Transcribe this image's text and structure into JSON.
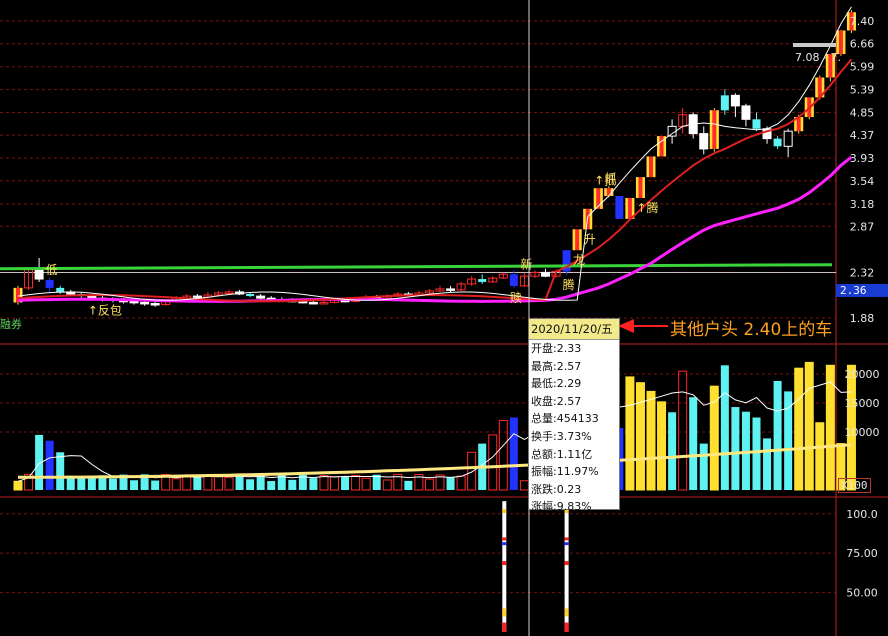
{
  "chart_data": [
    {
      "type": "candlestick",
      "panel": "price",
      "ylim": [
        1.88,
        8.0
      ],
      "y_ticks": [
        "7.40",
        "6.66",
        "5.99",
        "5.39",
        "4.85",
        "4.37",
        "3.93",
        "3.54",
        "3.18",
        "2.87",
        "2.32",
        "1.88"
      ],
      "current_price_label": "2.36",
      "range_label": "7.08 - 7.",
      "candles": [
        {
          "o": 2.02,
          "c": 2.16,
          "h": 2.18,
          "l": 2.0,
          "col": "yellow"
        },
        {
          "o": 2.16,
          "c": 2.35,
          "h": 2.36,
          "l": 2.14,
          "col": "red"
        },
        {
          "o": 2.36,
          "c": 2.25,
          "h": 2.48,
          "l": 2.22,
          "col": "white"
        },
        {
          "o": 2.24,
          "c": 2.16,
          "h": 2.26,
          "l": 2.12,
          "col": "blue"
        },
        {
          "o": 2.16,
          "c": 2.12,
          "h": 2.18,
          "l": 2.1,
          "col": "cyan"
        },
        {
          "o": 2.12,
          "c": 2.1,
          "h": 2.14,
          "l": 2.08,
          "col": "white"
        },
        {
          "o": 2.1,
          "c": 2.08,
          "h": 2.12,
          "l": 2.06,
          "col": "cyan"
        },
        {
          "o": 2.08,
          "c": 2.06,
          "h": 2.1,
          "l": 2.04,
          "col": "white"
        },
        {
          "o": 2.06,
          "c": 2.05,
          "h": 2.08,
          "l": 2.03,
          "col": "white"
        },
        {
          "o": 2.05,
          "c": 2.04,
          "h": 2.07,
          "l": 2.02,
          "col": "cyan"
        },
        {
          "o": 2.04,
          "c": 2.03,
          "h": 2.06,
          "l": 2.01,
          "col": "white"
        },
        {
          "o": 2.03,
          "c": 2.02,
          "h": 2.05,
          "l": 2.0,
          "col": "white"
        },
        {
          "o": 2.02,
          "c": 2.01,
          "h": 2.04,
          "l": 1.99,
          "col": "white"
        },
        {
          "o": 2.01,
          "c": 2.0,
          "h": 2.03,
          "l": 1.98,
          "col": "white"
        },
        {
          "o": 2.0,
          "c": 2.03,
          "h": 2.05,
          "l": 1.99,
          "col": "red"
        },
        {
          "o": 2.03,
          "c": 2.06,
          "h": 2.08,
          "l": 2.02,
          "col": "red"
        },
        {
          "o": 2.06,
          "c": 2.08,
          "h": 2.1,
          "l": 2.05,
          "col": "red"
        },
        {
          "o": 2.08,
          "c": 2.07,
          "h": 2.1,
          "l": 2.05,
          "col": "white"
        },
        {
          "o": 2.07,
          "c": 2.09,
          "h": 2.12,
          "l": 2.06,
          "col": "red"
        },
        {
          "o": 2.09,
          "c": 2.11,
          "h": 2.13,
          "l": 2.08,
          "col": "red"
        },
        {
          "o": 2.11,
          "c": 2.12,
          "h": 2.14,
          "l": 2.1,
          "col": "red"
        },
        {
          "o": 2.12,
          "c": 2.1,
          "h": 2.14,
          "l": 2.09,
          "col": "white"
        },
        {
          "o": 2.1,
          "c": 2.08,
          "h": 2.12,
          "l": 2.07,
          "col": "cyan"
        },
        {
          "o": 2.08,
          "c": 2.06,
          "h": 2.1,
          "l": 2.05,
          "col": "white"
        },
        {
          "o": 2.06,
          "c": 2.05,
          "h": 2.08,
          "l": 2.04,
          "col": "white"
        },
        {
          "o": 2.05,
          "c": 2.04,
          "h": 2.07,
          "l": 2.03,
          "col": "cyan"
        },
        {
          "o": 2.04,
          "c": 2.03,
          "h": 2.06,
          "l": 2.02,
          "col": "white"
        },
        {
          "o": 2.03,
          "c": 2.02,
          "h": 2.05,
          "l": 2.01,
          "col": "white"
        },
        {
          "o": 2.02,
          "c": 2.01,
          "h": 2.04,
          "l": 2.0,
          "col": "white"
        },
        {
          "o": 2.01,
          "c": 2.02,
          "h": 2.04,
          "l": 2.0,
          "col": "red"
        },
        {
          "o": 2.02,
          "c": 2.04,
          "h": 2.06,
          "l": 2.01,
          "col": "red"
        },
        {
          "o": 2.04,
          "c": 2.03,
          "h": 2.06,
          "l": 2.02,
          "col": "white"
        },
        {
          "o": 2.03,
          "c": 2.05,
          "h": 2.07,
          "l": 2.02,
          "col": "red"
        },
        {
          "o": 2.05,
          "c": 2.07,
          "h": 2.09,
          "l": 2.04,
          "col": "red"
        },
        {
          "o": 2.07,
          "c": 2.06,
          "h": 2.09,
          "l": 2.05,
          "col": "white"
        },
        {
          "o": 2.06,
          "c": 2.08,
          "h": 2.1,
          "l": 2.05,
          "col": "red"
        },
        {
          "o": 2.08,
          "c": 2.1,
          "h": 2.12,
          "l": 2.07,
          "col": "red"
        },
        {
          "o": 2.1,
          "c": 2.09,
          "h": 2.12,
          "l": 2.08,
          "col": "white"
        },
        {
          "o": 2.09,
          "c": 2.11,
          "h": 2.13,
          "l": 2.08,
          "col": "red"
        },
        {
          "o": 2.11,
          "c": 2.13,
          "h": 2.15,
          "l": 2.1,
          "col": "red"
        },
        {
          "o": 2.13,
          "c": 2.15,
          "h": 2.18,
          "l": 2.12,
          "col": "red"
        },
        {
          "o": 2.15,
          "c": 2.14,
          "h": 2.18,
          "l": 2.12,
          "col": "white"
        },
        {
          "o": 2.14,
          "c": 2.2,
          "h": 2.22,
          "l": 2.13,
          "col": "red"
        },
        {
          "o": 2.2,
          "c": 2.25,
          "h": 2.28,
          "l": 2.18,
          "col": "red"
        },
        {
          "o": 2.25,
          "c": 2.22,
          "h": 2.3,
          "l": 2.2,
          "col": "cyan"
        },
        {
          "o": 2.22,
          "c": 2.26,
          "h": 2.28,
          "l": 2.21,
          "col": "red"
        },
        {
          "o": 2.26,
          "c": 2.3,
          "h": 2.32,
          "l": 2.25,
          "col": "red"
        },
        {
          "o": 2.3,
          "c": 2.18,
          "h": 2.34,
          "l": 2.16,
          "col": "blue"
        },
        {
          "o": 2.18,
          "c": 2.28,
          "h": 2.32,
          "l": 2.17,
          "col": "red"
        },
        {
          "o": 2.28,
          "c": 2.32,
          "h": 2.34,
          "l": 2.26,
          "col": "red"
        },
        {
          "o": 2.32,
          "c": 2.28,
          "h": 2.36,
          "l": 2.27,
          "col": "white"
        },
        {
          "o": 2.28,
          "c": 2.33,
          "h": 2.35,
          "l": 2.27,
          "col": "red"
        },
        {
          "o": 2.33,
          "c": 2.57,
          "h": 2.57,
          "l": 2.29,
          "col": "blue"
        },
        {
          "o": 2.57,
          "c": 2.83,
          "h": 2.83,
          "l": 2.57,
          "col": "yellow"
        },
        {
          "o": 2.83,
          "c": 3.11,
          "h": 3.11,
          "l": 2.83,
          "col": "yellow"
        },
        {
          "o": 3.11,
          "c": 3.42,
          "h": 3.42,
          "l": 3.11,
          "col": "yellow"
        },
        {
          "o": 3.42,
          "c": 3.3,
          "h": 3.45,
          "l": 3.28,
          "col": "yellow"
        },
        {
          "o": 3.3,
          "c": 2.97,
          "h": 3.3,
          "l": 2.97,
          "col": "blue"
        },
        {
          "o": 2.97,
          "c": 3.27,
          "h": 3.27,
          "l": 2.97,
          "col": "yellow"
        },
        {
          "o": 3.27,
          "c": 3.6,
          "h": 3.6,
          "l": 3.27,
          "col": "yellow"
        },
        {
          "o": 3.6,
          "c": 3.96,
          "h": 3.96,
          "l": 3.6,
          "col": "yellow"
        },
        {
          "o": 3.96,
          "c": 4.35,
          "h": 4.35,
          "l": 3.96,
          "col": "yellow"
        },
        {
          "o": 4.35,
          "c": 4.55,
          "h": 4.7,
          "l": 4.2,
          "col": "white"
        },
        {
          "o": 4.55,
          "c": 4.8,
          "h": 4.95,
          "l": 4.4,
          "col": "red"
        },
        {
          "o": 4.8,
          "c": 4.4,
          "h": 4.85,
          "l": 4.3,
          "col": "white"
        },
        {
          "o": 4.4,
          "c": 4.1,
          "h": 4.55,
          "l": 4.0,
          "col": "white"
        },
        {
          "o": 4.1,
          "c": 4.9,
          "h": 4.95,
          "l": 4.05,
          "col": "yellow"
        },
        {
          "o": 4.9,
          "c": 5.25,
          "h": 5.4,
          "l": 4.8,
          "col": "cyan"
        },
        {
          "o": 5.25,
          "c": 5.0,
          "h": 5.3,
          "l": 4.75,
          "col": "white"
        },
        {
          "o": 5.0,
          "c": 4.7,
          "h": 5.05,
          "l": 4.55,
          "col": "white"
        },
        {
          "o": 4.7,
          "c": 4.5,
          "h": 4.85,
          "l": 4.45,
          "col": "cyan"
        },
        {
          "o": 4.5,
          "c": 4.3,
          "h": 4.55,
          "l": 4.2,
          "col": "white"
        },
        {
          "o": 4.3,
          "c": 4.15,
          "h": 4.35,
          "l": 4.1,
          "col": "cyan"
        },
        {
          "o": 4.15,
          "c": 4.45,
          "h": 4.5,
          "l": 3.95,
          "col": "white"
        },
        {
          "o": 4.45,
          "c": 4.75,
          "h": 4.8,
          "l": 4.4,
          "col": "yellow"
        },
        {
          "o": 4.75,
          "c": 5.2,
          "h": 5.2,
          "l": 4.7,
          "col": "yellow"
        },
        {
          "o": 5.2,
          "c": 5.7,
          "h": 5.75,
          "l": 5.15,
          "col": "yellow"
        },
        {
          "o": 5.7,
          "c": 6.35,
          "h": 6.35,
          "l": 5.6,
          "col": "yellow"
        },
        {
          "o": 6.35,
          "c": 7.08,
          "h": 7.1,
          "l": 6.3,
          "col": "yellow"
        },
        {
          "o": 7.08,
          "c": 7.7,
          "h": 7.78,
          "l": 7.0,
          "col": "yellow"
        }
      ],
      "ma_white_tail": [
        3.0,
        3.15,
        3.3,
        3.5,
        3.7,
        3.9,
        4.1,
        4.25,
        4.4,
        4.55,
        4.6,
        4.62,
        4.6,
        4.55,
        4.52,
        4.5,
        4.48,
        4.5,
        4.6,
        4.8,
        5.1,
        5.5,
        6.0,
        6.6,
        7.3,
        7.9
      ],
      "ma_red_tail": [
        2.33,
        2.38,
        2.45,
        2.52,
        2.6,
        2.7,
        2.82,
        2.96,
        3.1,
        3.24,
        3.38,
        3.52,
        3.66,
        3.8,
        3.92,
        4.02,
        4.1,
        4.2,
        4.3,
        4.38,
        4.45,
        4.5,
        4.6,
        4.75,
        4.95,
        5.2,
        5.5,
        5.85,
        6.2
      ],
      "ma_magenta_tail": [
        2.05,
        2.07,
        2.1,
        2.13,
        2.16,
        2.2,
        2.25,
        2.3,
        2.36,
        2.42,
        2.5,
        2.58,
        2.66,
        2.74,
        2.82,
        2.88,
        2.92,
        2.96,
        3.0,
        3.04,
        3.08,
        3.12,
        3.18,
        3.25,
        3.35,
        3.48,
        3.62,
        3.8,
        3.95
      ],
      "ma_green_level": 2.36,
      "signal_labels": [
        {
          "i": 3,
          "text": "低",
          "pos": "above"
        },
        {
          "i": 7,
          "text": "↑反包",
          "pos": "below"
        },
        {
          "i": 47,
          "text": "赎",
          "pos": "below"
        },
        {
          "i": 48,
          "text": "新",
          "pos": "above"
        },
        {
          "i": 52,
          "text": "腾",
          "pos": "below"
        },
        {
          "i": 53,
          "text": "龙",
          "pos": "below"
        },
        {
          "i": 54,
          "text": "升",
          "pos": "below"
        },
        {
          "i": 55,
          "text": "↑抵",
          "pos": "above"
        },
        {
          "i": 56,
          "text": "抓",
          "pos": "above"
        },
        {
          "i": 59,
          "text": "↑腾",
          "pos": "below"
        }
      ],
      "left_label": "融券"
    },
    {
      "type": "bar",
      "panel": "volume",
      "unit_label": "X100",
      "y_ticks": [
        "20000",
        "15000",
        "10000"
      ],
      "ylim": [
        0,
        25000
      ]
    },
    {
      "type": "indicator",
      "panel": "bottom",
      "y_ticks": [
        "100.0",
        "75.00",
        "50.00"
      ],
      "ylim": [
        25,
        110
      ]
    }
  ],
  "tooltip": {
    "date": "2020/11/20/五",
    "rows": [
      "开盘:2.33",
      "最高:2.57",
      "最低:2.29",
      "收盘:2.57",
      "总量:454133",
      "换手:3.73%",
      "总额:1.11亿",
      "振幅:11.97%",
      "涨跌:0.23",
      "涨幅:9.83%"
    ]
  },
  "annotation": "其他户头 2.40上的车",
  "colors": {
    "up_red": "#ff2a2a",
    "yellow": "#ffe030",
    "cyan": "#5ef2f2",
    "blue": "#2232ff",
    "magenta": "#ff20ff",
    "green": "#3ad43a",
    "grid": "#7a1010",
    "annotation": "#ffa020"
  }
}
